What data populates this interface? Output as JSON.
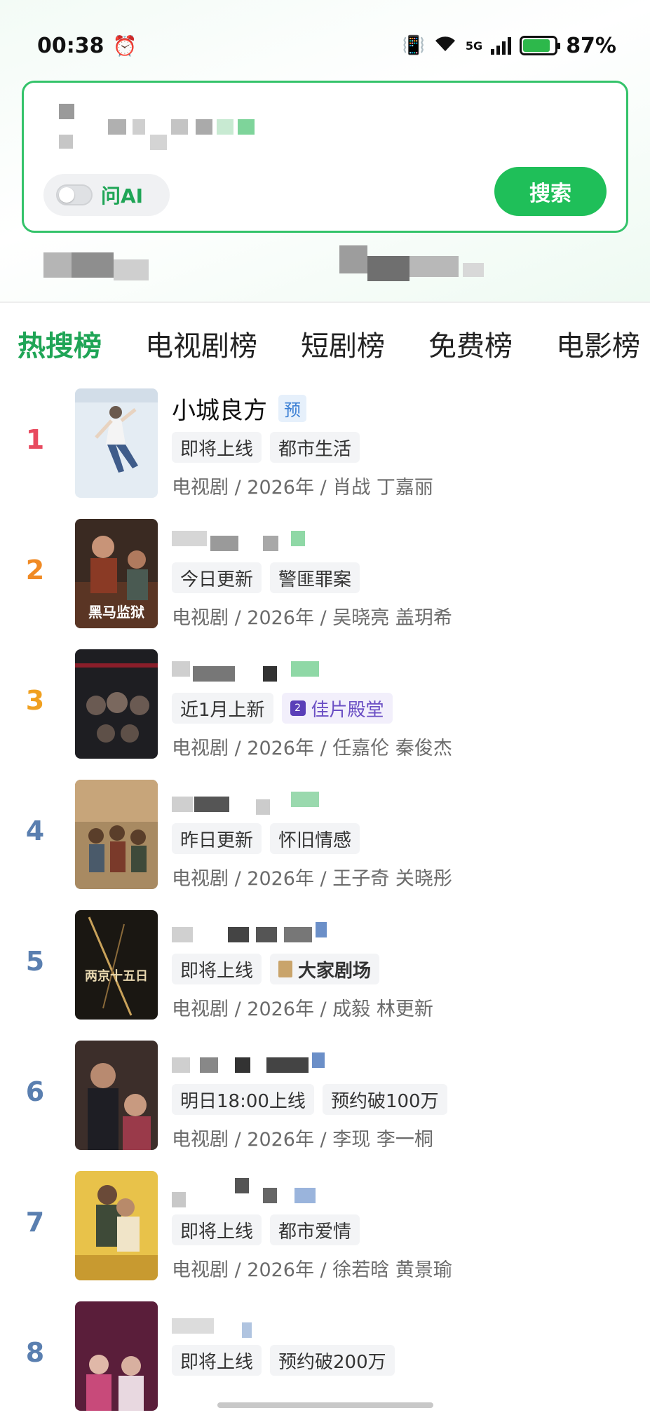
{
  "status_bar": {
    "time": "00:38",
    "network": "5G",
    "battery_percent": "87%",
    "battery_level": 0.87
  },
  "search": {
    "ai_toggle_label": "问AI",
    "search_button_label": "搜索"
  },
  "tabs": [
    {
      "label": "热搜榜",
      "active": true
    },
    {
      "label": "电视剧榜",
      "active": false
    },
    {
      "label": "短剧榜",
      "active": false
    },
    {
      "label": "免费榜",
      "active": false
    },
    {
      "label": "电影榜",
      "active": false
    }
  ],
  "items": [
    {
      "rank": "1",
      "title": "小城良方",
      "badge": "预",
      "tags": [
        "即将上线",
        "都市生活"
      ],
      "meta": "电视剧 / 2026年 / 肖战 丁嘉丽"
    },
    {
      "rank": "2",
      "title": "",
      "badge": "",
      "tags": [
        "今日更新",
        "警匪罪案"
      ],
      "meta": "电视剧 / 2026年 / 吴晓亮 盖玥希"
    },
    {
      "rank": "3",
      "title": "",
      "badge": "",
      "tags": [
        "近1月上新",
        "佳片殿堂"
      ],
      "meta": "电视剧 / 2026年 / 任嘉伦 秦俊杰"
    },
    {
      "rank": "4",
      "title": "",
      "badge": "",
      "tags": [
        "昨日更新",
        "怀旧情感"
      ],
      "meta": "电视剧 / 2026年 / 王子奇 关晓彤"
    },
    {
      "rank": "5",
      "title": "",
      "badge": "",
      "tags": [
        "即将上线",
        "大家剧场"
      ],
      "meta": "电视剧 / 2026年 / 成毅 林更新"
    },
    {
      "rank": "6",
      "title": "",
      "badge": "",
      "tags": [
        "明日18:00上线",
        "预约破100万"
      ],
      "meta": "电视剧 / 2026年 / 李现 李一桐"
    },
    {
      "rank": "7",
      "title": "",
      "badge": "",
      "tags": [
        "即将上线",
        "都市爱情"
      ],
      "meta": "电视剧 / 2026年 / 徐若晗 黄景瑜"
    },
    {
      "rank": "8",
      "title": "",
      "badge": "",
      "tags": [
        "即将上线",
        "预约破200万"
      ],
      "meta": ""
    }
  ],
  "poster_texts": {
    "2": "黑马监狱",
    "5": "两京十五日"
  },
  "colors": {
    "accent_green": "#1fa556",
    "rank_1": "#e84a5f",
    "rank_2": "#f08a24",
    "rank_3": "#f0a020",
    "rank_other": "#5a7fb0"
  }
}
